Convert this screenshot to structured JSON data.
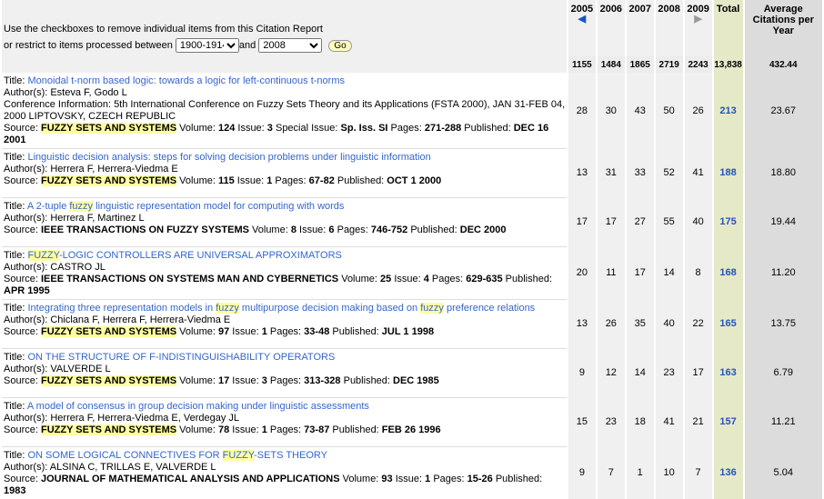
{
  "header": {
    "line1": "Use the checkboxes to remove individual items from this Citation Report",
    "line2_prefix": "or restrict to items processed between",
    "from_year": "1900-1914",
    "and_label": "and",
    "to_year": "2008",
    "go_label": "Go",
    "years": [
      "2005",
      "2006",
      "2007",
      "2008",
      "2009"
    ],
    "total_label": "Total",
    "avg_label": "Average Citations per Year"
  },
  "totals": [
    "1155",
    "1484",
    "1865",
    "2719",
    "2243",
    "13,838",
    "432.44"
  ],
  "records": [
    {
      "title": "Monoidal t-norm based logic: towards a logic for left-continuous t-norms",
      "authors": "Author(s): Esteva F, Godo L",
      "conf": "Conference Information: 5th International Conference on Fuzzy Sets Theory and its Applications (FSTA 2000), JAN 31-FEB 04, 2000 LIPTOVSKY, CZECH REPUBLIC",
      "source": "FUZZY SETS AND SYSTEMS",
      "volume": "124",
      "issue": "3",
      "special": "Sp. Iss. SI",
      "pages": "271-288",
      "published": "DEC 16 2001",
      "counts": [
        "28",
        "30",
        "43",
        "50",
        "26"
      ],
      "total": "213",
      "avg": "23.67"
    },
    {
      "title": "Linguistic decision analysis: steps for solving decision problems under linguistic information",
      "authors": "Author(s): Herrera F, Herrera-Viedma E",
      "source": "FUZZY SETS AND SYSTEMS",
      "volume": "115",
      "issue": "1",
      "pages": "67-82",
      "published": "OCT 1 2000",
      "counts": [
        "13",
        "31",
        "33",
        "52",
        "41"
      ],
      "total": "188",
      "avg": "18.80"
    },
    {
      "title_pre": "A 2-tuple ",
      "title_hl": "fuzzy",
      "title_post": " linguistic representation model for computing with words",
      "authors": "Author(s): Herrera F, Martinez L",
      "source": "IEEE TRANSACTIONS ON FUZZY SYSTEMS",
      "volume": "8",
      "issue": "6",
      "pages": "746-752",
      "published": "DEC 2000",
      "counts": [
        "17",
        "17",
        "27",
        "55",
        "40"
      ],
      "total": "175",
      "avg": "19.44"
    },
    {
      "title_hl": "FUZZY",
      "title_post": "-LOGIC CONTROLLERS ARE UNIVERSAL APPROXIMATORS",
      "authors": "Author(s): CASTRO JL",
      "source": "IEEE TRANSACTIONS ON SYSTEMS MAN AND CYBERNETICS",
      "volume": "25",
      "issue": "4",
      "pages": "629-635",
      "published": "APR 1995",
      "counts": [
        "20",
        "11",
        "17",
        "14",
        "8"
      ],
      "total": "168",
      "avg": "11.20"
    },
    {
      "title_pre": "Integrating three representation models in ",
      "title_hl": "fuzzy",
      "title_mid": " multipurpose decision making based on ",
      "title_hl2": "fuzzy",
      "title_post": " preference relations",
      "authors": "Author(s): Chiclana F, Herrera F, Herrera-Viedma E",
      "source": "FUZZY SETS AND SYSTEMS",
      "volume": "97",
      "issue": "1",
      "pages": "33-48",
      "published": "JUL 1 1998",
      "counts": [
        "13",
        "26",
        "35",
        "40",
        "22"
      ],
      "total": "165",
      "avg": "13.75"
    },
    {
      "title": "ON THE STRUCTURE OF F-INDISTINGUISHABILITY OPERATORS",
      "authors": "Author(s): VALVERDE L",
      "source": "FUZZY SETS AND SYSTEMS",
      "volume": "17",
      "issue": "3",
      "pages": "313-328",
      "published": "DEC 1985",
      "counts": [
        "9",
        "12",
        "14",
        "23",
        "17"
      ],
      "total": "163",
      "avg": "6.79"
    },
    {
      "title": "A model of consensus in group decision making under linguistic assessments",
      "authors": "Author(s): Herrera F, Herrera-Viedma E, Verdegay JL",
      "source": "FUZZY SETS AND SYSTEMS",
      "volume": "78",
      "issue": "1",
      "pages": "73-87",
      "published": "FEB 26 1996",
      "counts": [
        "15",
        "23",
        "18",
        "41",
        "21"
      ],
      "total": "157",
      "avg": "11.21"
    },
    {
      "title_pre": "ON SOME LOGICAL CONNECTIVES FOR ",
      "title_hl": "FUZZY",
      "title_post": "-SETS THEORY",
      "authors": "Author(s): ALSINA C, TRILLAS E, VALVERDE L",
      "source": "JOURNAL OF MATHEMATICAL ANALYSIS AND APPLICATIONS",
      "volume": "93",
      "issue": "1",
      "pages": "15-26",
      "published": "1983",
      "counts": [
        "9",
        "7",
        "1",
        "10",
        "7"
      ],
      "total": "136",
      "avg": "5.04"
    }
  ],
  "labels": {
    "title": "Title:",
    "source": "Source:",
    "volume": "Volume:",
    "issue": "Issue:",
    "special": "Special Issue:",
    "pages": "Pages:",
    "published": "Published:"
  },
  "colors": {
    "link": "#3366cc",
    "highlight": "#ffffa0",
    "total_col": "#e6e9c8",
    "avg_col": "#dcdcdc"
  }
}
